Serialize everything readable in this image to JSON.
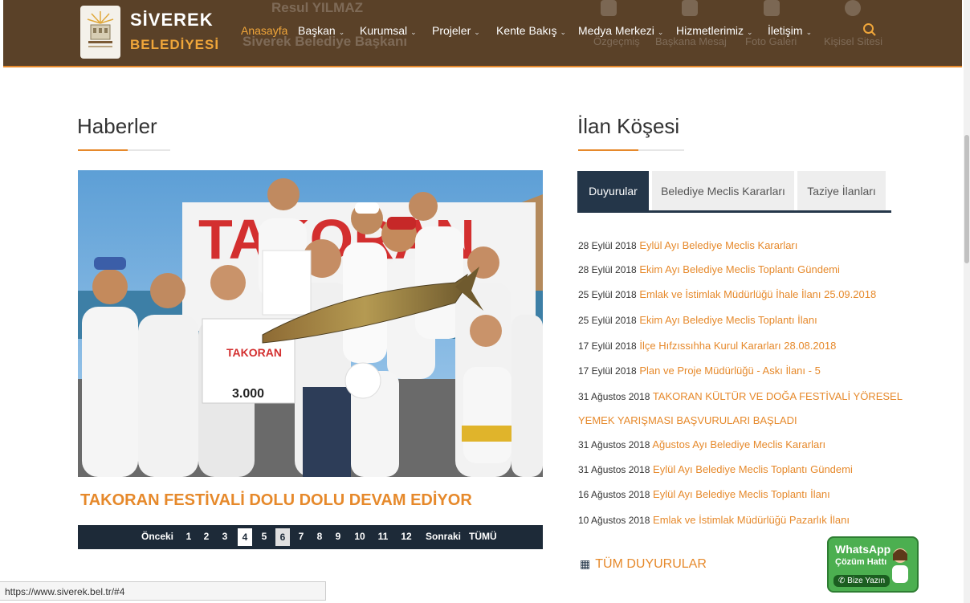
{
  "nav": {
    "brand_top": "SİVEREK",
    "brand_bottom": "BELEDİYESİ",
    "ghost_texts": {
      "name": "Resul YILMAZ",
      "subtitle": "Siverek Belediye Başkanı",
      "quick1": "Özgeçmiş",
      "quick2": "Başkana Mesaj",
      "quick3": "Foto Galeri",
      "quick4": "Kişisel Sitesi"
    },
    "items": [
      {
        "label": "Anasayfa",
        "dropdown": false
      },
      {
        "label": "Başkan",
        "dropdown": true
      },
      {
        "label": "Kurumsal",
        "dropdown": true
      },
      {
        "label": "Projeler",
        "dropdown": true
      },
      {
        "label": "Kente Bakış",
        "dropdown": true
      },
      {
        "label": "Medya Merkezi",
        "dropdown": true
      },
      {
        "label": "Hizmetlerimiz",
        "dropdown": true
      },
      {
        "label": "İletişim",
        "dropdown": true
      }
    ],
    "caret": "⌄",
    "search_icon": "search-icon"
  },
  "news": {
    "title": "Haberler",
    "headline": "TAKORAN FESTİVALİ DOLU DOLU DEVAM EDİYOR",
    "banner_text": "TAKORAN",
    "check_text": "3.000",
    "pager": {
      "prev": "Önceki",
      "pages": [
        "1",
        "2",
        "3",
        "4",
        "5",
        "6",
        "7",
        "8",
        "9",
        "10",
        "11",
        "12"
      ],
      "current": "4",
      "next": "Sonraki",
      "all": "TÜMÜ"
    }
  },
  "ilan": {
    "title": "İlan Köşesi",
    "tabs": [
      "Duyurular",
      "Belediye Meclis Kararları",
      "Taziye İlanları"
    ],
    "announcements": [
      {
        "date": "28 Eylül 2018",
        "title": "Eylül Ayı Belediye Meclis Kararları"
      },
      {
        "date": "28 Eylül 2018",
        "title": "Ekim Ayı Belediye Meclis Toplantı Gündemi"
      },
      {
        "date": "25 Eylül 2018",
        "title": "Emlak ve İstimlak Müdürlüğü İhale İlanı 25.09.2018"
      },
      {
        "date": "25 Eylül 2018",
        "title": "Ekim Ayı Belediye Meclis Toplantı İlanı"
      },
      {
        "date": "17 Eylül 2018",
        "title": "İlçe Hıfzıssıhha Kurul Kararları 28.08.2018"
      },
      {
        "date": "17 Eylül 2018",
        "title": "Plan ve Proje Müdürlüğü - Askı İlanı - 5"
      },
      {
        "date": "31 Ağustos 2018",
        "title": "TAKORAN KÜLTÜR VE DOĞA FESTİVALİ YÖRESEL",
        "title2": "YEMEK YARIŞMASI BAŞVURULARI BAŞLADI"
      },
      {
        "date": "31 Ağustos 2018",
        "title": "Ağustos Ayı Belediye Meclis Kararları"
      },
      {
        "date": "31 Ağustos 2018",
        "title": "Eylül Ayı Belediye Meclis Toplantı Gündemi"
      },
      {
        "date": "16 Ağustos 2018",
        "title": "Eylül Ayı Belediye Meclis Toplantı İlanı"
      },
      {
        "date": "10 Ağustos 2018",
        "title": "Emlak ve İstimlak Müdürlüğü Pazarlık İlanı"
      }
    ],
    "all_link": "TÜM DUYURULAR",
    "grid_icon": "▦"
  },
  "whatsapp": {
    "title": "WhatsApp",
    "subtitle": "Çözüm Hattı",
    "button": "Bize Yazın"
  },
  "status_url": "https://www.siverek.bel.tr/#4",
  "colors": {
    "nav_bg": "#5a4128",
    "accent": "#e6892b",
    "tab_active": "#243649",
    "pager_bg": "#1d2a38"
  }
}
